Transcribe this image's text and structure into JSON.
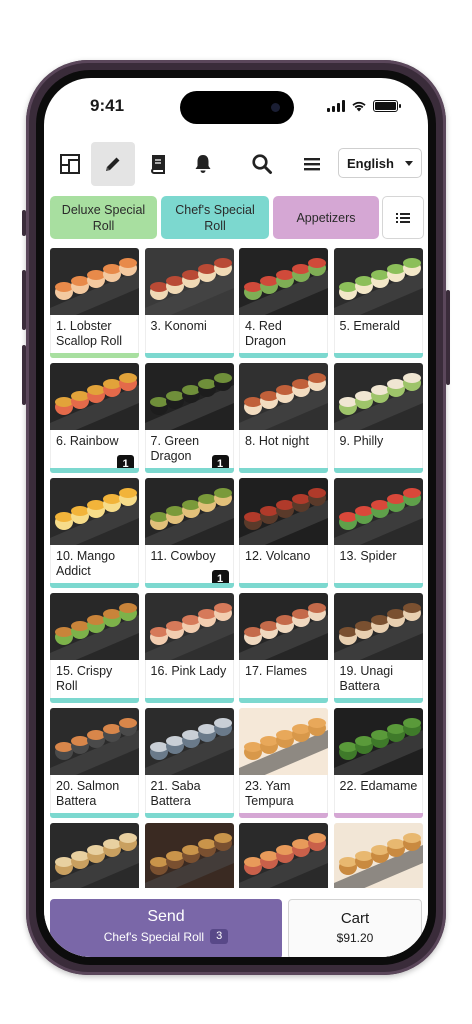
{
  "status_bar": {
    "time": "9:41"
  },
  "toolbar": {
    "language": "English",
    "icons": [
      "layout-icon",
      "pencil-icon",
      "menu-book-icon",
      "bell-icon",
      "search-icon",
      "hamburger-icon"
    ]
  },
  "categories": [
    {
      "label": "Deluxe Special Roll",
      "color": "#a8dfa0"
    },
    {
      "label": "Chef's Special Roll",
      "color": "#7cd8cf"
    },
    {
      "label": "Appetizers",
      "color": "#d5a7d4"
    }
  ],
  "items": [
    {
      "name": "1. Lobster Scallop Roll",
      "bar": "#a8dfa0",
      "qty": ""
    },
    {
      "name": "3. Konomi",
      "bar": "#7cd8cf",
      "qty": ""
    },
    {
      "name": "4. Red Dragon",
      "bar": "#7cd8cf",
      "qty": ""
    },
    {
      "name": "5. Emerald",
      "bar": "#7cd8cf",
      "qty": ""
    },
    {
      "name": "6. Rainbow",
      "bar": "#7cd8cf",
      "qty": "1"
    },
    {
      "name": "7. Green Dragon",
      "bar": "#7cd8cf",
      "qty": "1"
    },
    {
      "name": "8. Hot night",
      "bar": "#7cd8cf",
      "qty": ""
    },
    {
      "name": "9. Philly",
      "bar": "#7cd8cf",
      "qty": ""
    },
    {
      "name": "10. Mango Addict",
      "bar": "#7cd8cf",
      "qty": ""
    },
    {
      "name": "11. Cowboy",
      "bar": "#7cd8cf",
      "qty": "1"
    },
    {
      "name": "12. Volcano",
      "bar": "#7cd8cf",
      "qty": ""
    },
    {
      "name": "13. Spider",
      "bar": "#7cd8cf",
      "qty": ""
    },
    {
      "name": "15. Crispy Roll",
      "bar": "#7cd8cf",
      "qty": ""
    },
    {
      "name": "16. Pink Lady",
      "bar": "#7cd8cf",
      "qty": ""
    },
    {
      "name": "17. Flames",
      "bar": "#7cd8cf",
      "qty": ""
    },
    {
      "name": "19. Unagi Battera",
      "bar": "#7cd8cf",
      "qty": ""
    },
    {
      "name": "20. Salmon Battera",
      "bar": "#7cd8cf",
      "qty": ""
    },
    {
      "name": "21. Saba Battera",
      "bar": "#7cd8cf",
      "qty": ""
    },
    {
      "name": "23. Yam Tempura",
      "bar": "#d5a7d4",
      "qty": ""
    },
    {
      "name": "22. Edamame",
      "bar": "#d5a7d4",
      "qty": ""
    },
    {
      "name": "",
      "bar": "#d5a7d4",
      "qty": ""
    },
    {
      "name": "",
      "bar": "#d5a7d4",
      "qty": ""
    },
    {
      "name": "",
      "bar": "#d5a7d4",
      "qty": ""
    },
    {
      "name": "",
      "bar": "#d5a7d4",
      "qty": ""
    }
  ],
  "send": {
    "label": "Send",
    "category": "Chef's Special Roll",
    "count": "3",
    "color": "#7a67a8"
  },
  "cart": {
    "label": "Cart",
    "total": "$91.20"
  }
}
